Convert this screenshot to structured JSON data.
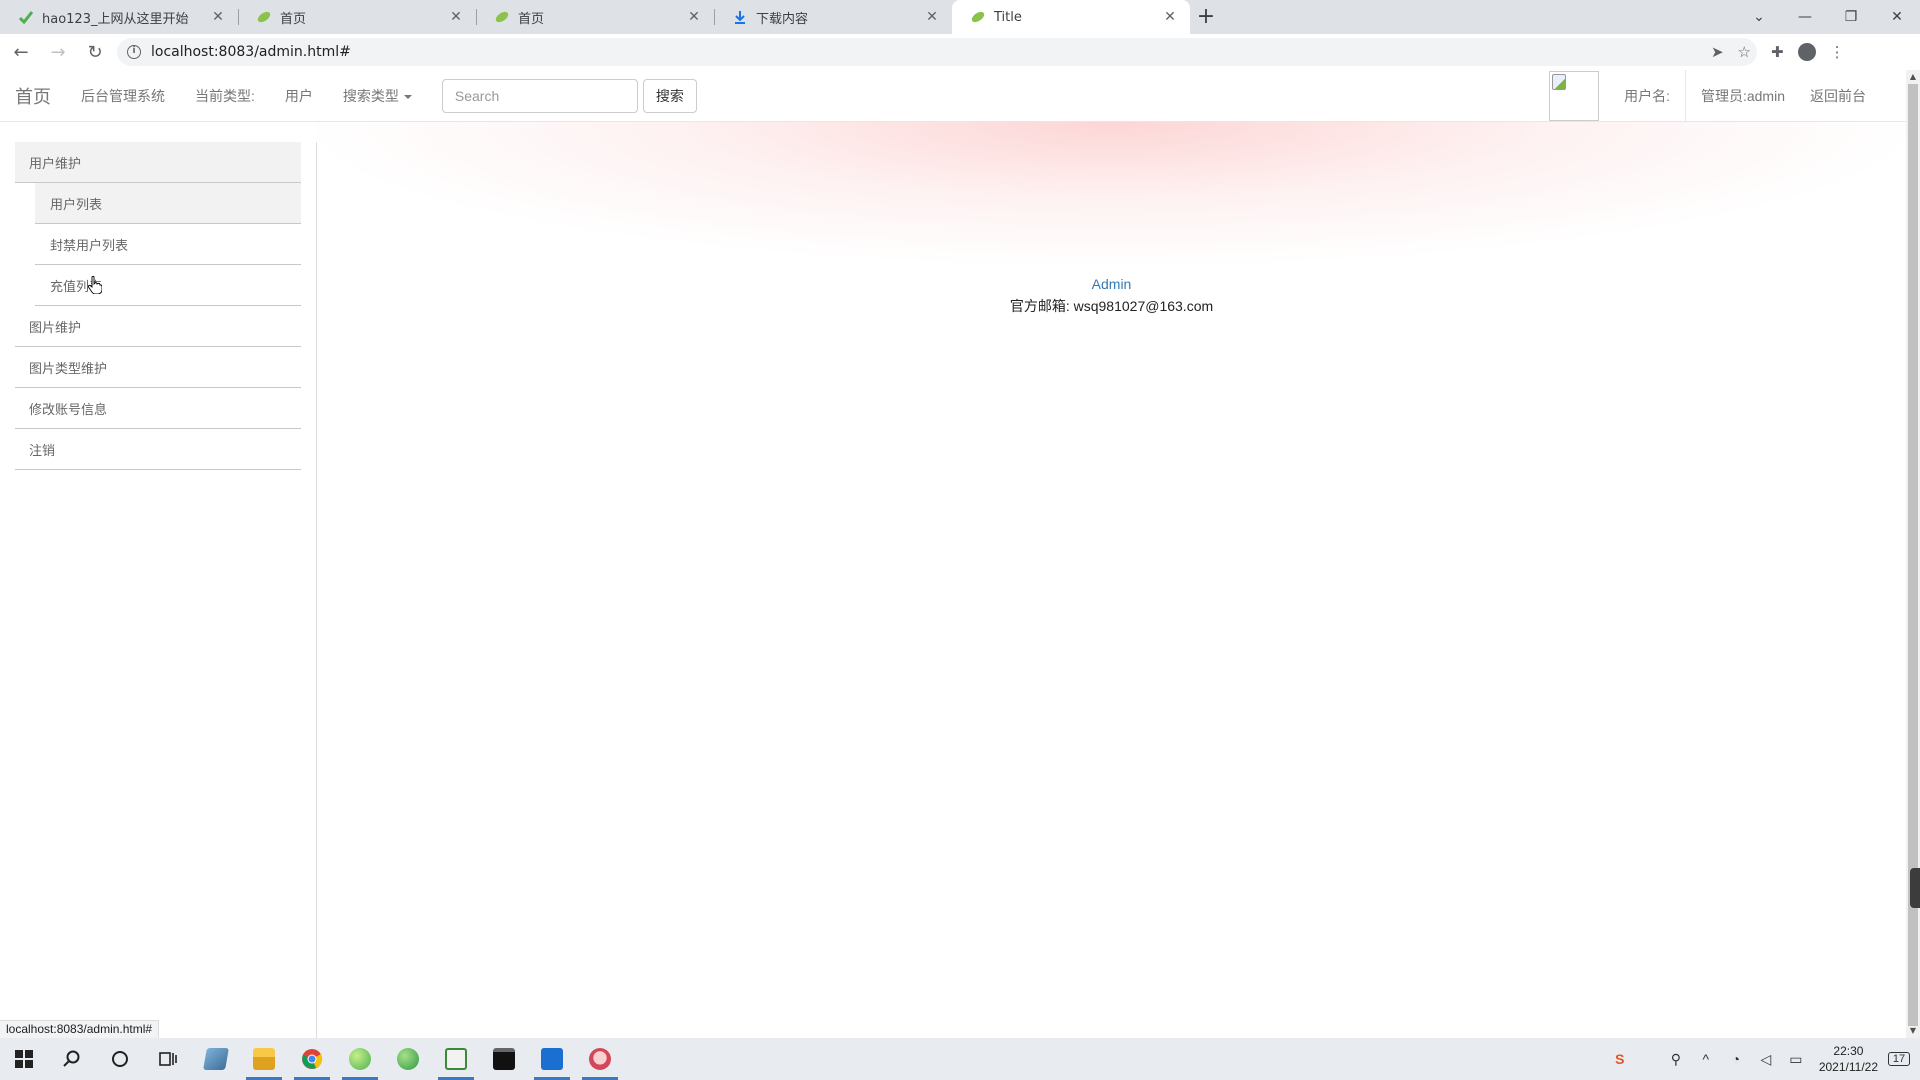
{
  "browser": {
    "tabs": [
      {
        "title": "hao123_上网从这里开始",
        "icon": "hao123-icon",
        "active": false
      },
      {
        "title": "首页",
        "icon": "leaf-icon",
        "active": false
      },
      {
        "title": "首页",
        "icon": "leaf-icon",
        "active": false
      },
      {
        "title": "下载内容",
        "icon": "download-icon",
        "active": false
      },
      {
        "title": "Title",
        "icon": "leaf-icon",
        "active": true
      }
    ],
    "url": "localhost:8083/admin.html#",
    "status_url": "localhost:8083/admin.html#"
  },
  "navbar": {
    "brand": "首页",
    "system_name": "后台管理系统",
    "current_type_label": "当前类型:",
    "current_type_value": "用户",
    "search_type_label": "搜索类型",
    "search_placeholder": "Search",
    "search_button": "搜索",
    "username_label": "用户名:",
    "admin_label": "管理员:admin",
    "back_label": "返回前台"
  },
  "sidebar": {
    "groups": [
      {
        "label": "用户维护",
        "open": true,
        "children": [
          "用户列表",
          "封禁用户列表",
          "充值列表"
        ]
      },
      {
        "label": "图片维护"
      },
      {
        "label": "图片类型维护"
      },
      {
        "label": "修改账号信息"
      },
      {
        "label": "注销"
      }
    ]
  },
  "main": {
    "admin_name": "Admin",
    "email_line": "官方邮箱: wsq981027@163.com"
  },
  "taskbar": {
    "time": "22:30",
    "date": "2021/11/22",
    "notification_count": "17"
  },
  "colors": {
    "link": "#337ab7",
    "nav_text": "#777777",
    "glow": "#fcc8c8",
    "taskbar": "#e8ecf0"
  }
}
